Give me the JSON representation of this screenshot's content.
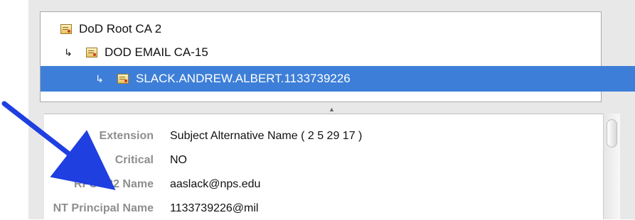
{
  "certificate_tree": {
    "items": [
      {
        "label": "DoD Root CA 2",
        "icon": "certificate-icon",
        "selected": false,
        "indent": 0
      },
      {
        "label": "DOD EMAIL CA-15",
        "icon": "certificate-icon",
        "selected": false,
        "indent": 1
      },
      {
        "label": "SLACK.ANDREW.ALBERT.1133739226",
        "icon": "certificate-icon",
        "selected": true,
        "indent": 2
      }
    ],
    "child_arrow": "↳"
  },
  "details": {
    "rows": [
      {
        "label": "Extension",
        "value": "Subject Alternative Name ( 2 5 29 17 )"
      },
      {
        "label": "Critical",
        "value": "NO"
      },
      {
        "label": "RFC 822 Name",
        "value": "aaslack@nps.edu"
      },
      {
        "label": "NT Principal Name",
        "value": "1133739226@mil"
      }
    ]
  },
  "colors": {
    "selection": "#3d7fd8",
    "label": "#8e8e8e",
    "annotation_arrow": "#1f3fe0"
  }
}
